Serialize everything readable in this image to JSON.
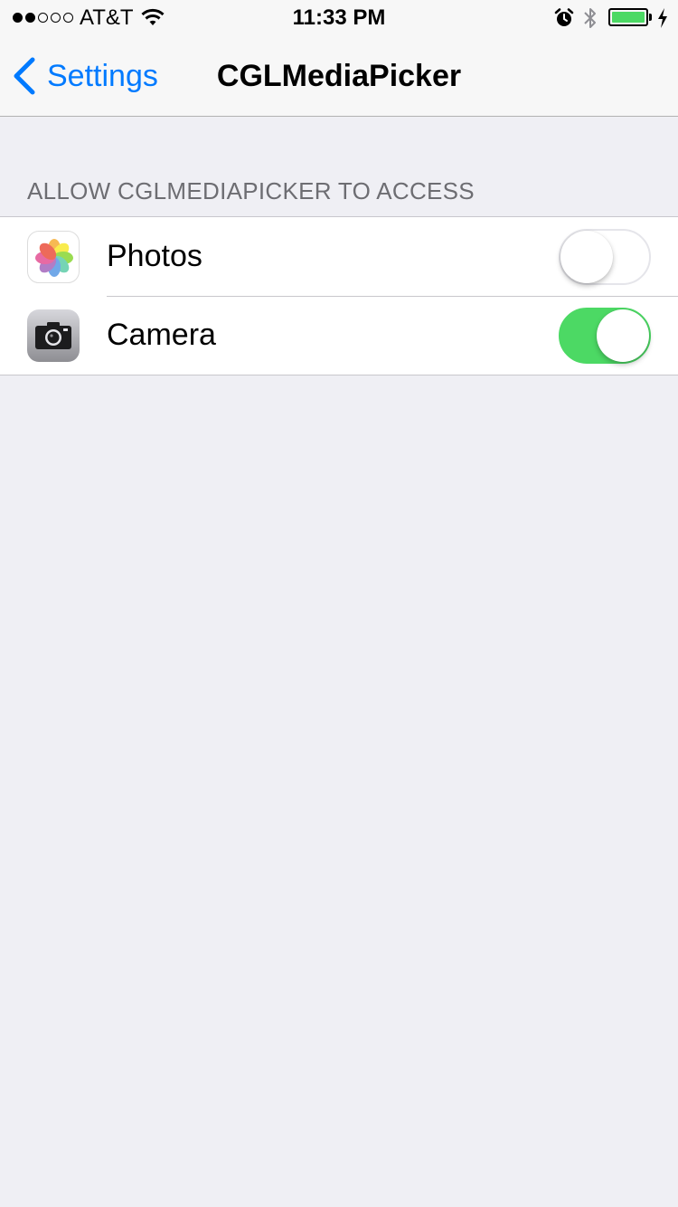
{
  "status_bar": {
    "signal_bars": [
      true,
      true,
      false,
      false,
      false
    ],
    "carrier": "AT&T",
    "time": "11:33 PM",
    "icons": [
      "wifi-icon",
      "alarm-icon",
      "bluetooth-icon",
      "battery-icon",
      "charging-icon"
    ],
    "battery_color": "#4cd964"
  },
  "nav": {
    "back_label": "Settings",
    "title": "CGLMediaPicker",
    "accent_color": "#007aff"
  },
  "section": {
    "header": "ALLOW CGLMEDIAPICKER TO ACCESS",
    "rows": [
      {
        "label": "Photos",
        "icon": "photos-icon",
        "enabled": false
      },
      {
        "label": "Camera",
        "icon": "camera-icon",
        "enabled": true
      }
    ]
  },
  "colors": {
    "background": "#efeff4",
    "toggle_on": "#4cd964"
  }
}
